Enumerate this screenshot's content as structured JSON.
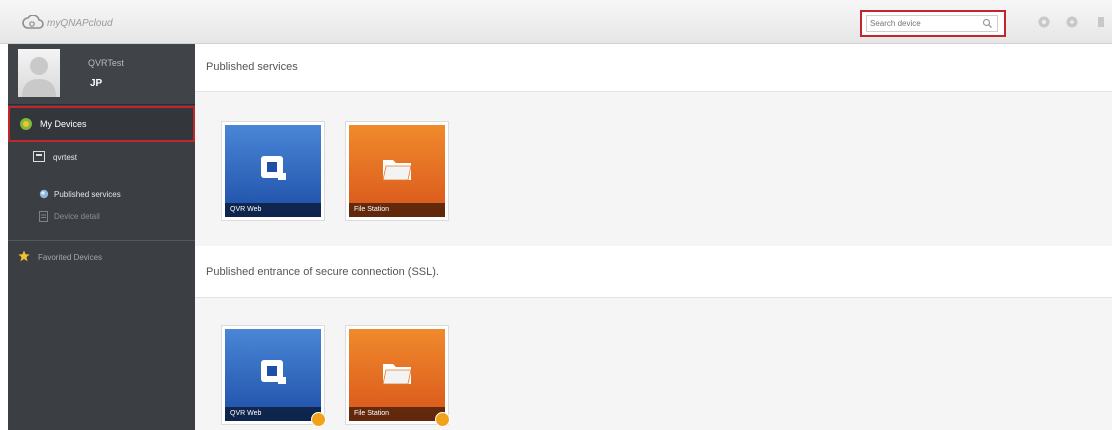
{
  "header": {
    "logo_text": "myQNAPcloud",
    "search_placeholder": "Search device",
    "icons": [
      "settings-icon",
      "help-icon",
      "more-icon"
    ]
  },
  "sidebar": {
    "username": "QVRTest",
    "role_icon_text": "JP",
    "my_devices_label": "My Devices",
    "device_name": "qvrtest",
    "sub_items": [
      {
        "label": "Published services",
        "active": true
      },
      {
        "label": "Device detail",
        "active": false
      }
    ],
    "favorites_label": "Favorited Devices"
  },
  "main": {
    "sections": [
      {
        "title": "Published services",
        "tiles": [
          {
            "label": "QVR Web",
            "color": "blue",
            "icon": "qvr-icon",
            "ssl": false
          },
          {
            "label": "File Station",
            "color": "orange",
            "icon": "folder-icon",
            "ssl": false
          }
        ]
      },
      {
        "title": "Published entrance of secure connection (SSL).",
        "tiles": [
          {
            "label": "QVR Web",
            "color": "blue",
            "icon": "qvr-icon",
            "ssl": true
          },
          {
            "label": "File Station",
            "color": "orange",
            "icon": "folder-icon",
            "ssl": true
          }
        ]
      }
    ]
  },
  "colors": {
    "highlight_border": "#c0272d",
    "sidebar_bg": "#3b3e43",
    "tile_blue": "#1d4fa7",
    "tile_orange": "#d9561b",
    "ssl_badge": "#f0a21a"
  }
}
